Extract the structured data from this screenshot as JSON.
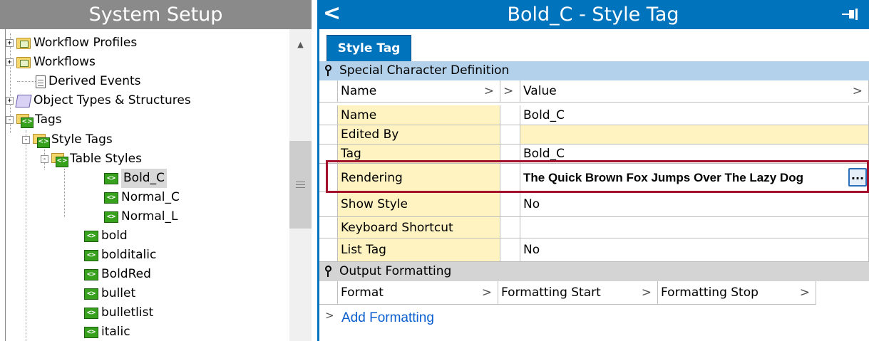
{
  "left_panel": {
    "title": "System Setup",
    "tree": [
      {
        "label": "Workflow Profiles",
        "icon": "folder-icon",
        "expander": "+"
      },
      {
        "label": "Workflows",
        "icon": "folder-icon",
        "expander": "+"
      },
      {
        "label": "Derived Events",
        "icon": "document-icon",
        "expander": ""
      },
      {
        "label": "Object Types & Structures",
        "icon": "object-types-icon",
        "expander": "+"
      },
      {
        "label": "Tags",
        "icon": "tags-folder-icon",
        "expander": "-"
      },
      {
        "label": "Style Tags",
        "icon": "tags-folder-icon",
        "expander": "-"
      },
      {
        "label": "Table Styles",
        "icon": "tags-folder-icon",
        "expander": "-"
      },
      {
        "label": "Bold_C",
        "icon": "tag-icon",
        "selected": true
      },
      {
        "label": "Normal_C",
        "icon": "tag-icon"
      },
      {
        "label": "Normal_L",
        "icon": "tag-icon"
      },
      {
        "label": "bold",
        "icon": "tag-icon"
      },
      {
        "label": "bolditalic",
        "icon": "tag-icon"
      },
      {
        "label": "BoldRed",
        "icon": "tag-icon"
      },
      {
        "label": "bullet",
        "icon": "tag-icon"
      },
      {
        "label": "bulletlist",
        "icon": "tag-icon"
      },
      {
        "label": "italic",
        "icon": "tag-icon"
      }
    ],
    "tag_icon_glyph": "<>",
    "expander_plus": "+",
    "expander_minus": "-"
  },
  "right_panel": {
    "title": "Bold_C - Style Tag",
    "back_glyph": "<",
    "tab": "Style Tag",
    "section1": {
      "header": "Special Character Definition",
      "columns": {
        "name": "Name",
        "value": "Value",
        "chev": ">"
      },
      "rows": [
        {
          "name": "Name",
          "value": "Bold_C"
        },
        {
          "name": "Edited By",
          "value": ""
        },
        {
          "name": "Tag",
          "value": "Bold_C"
        },
        {
          "name": "Rendering",
          "value": "The Quick Brown Fox Jumps Over The Lazy Dog",
          "button": "..."
        },
        {
          "name": "Show Style",
          "value": "No"
        },
        {
          "name": "Keyboard Shortcut",
          "value": ""
        },
        {
          "name": "List Tag",
          "value": "No"
        }
      ]
    },
    "section2": {
      "header": "Output Formatting",
      "columns": [
        "Format",
        "Formatting Start",
        "Formatting Stop"
      ],
      "add_label": "Add Formatting"
    }
  },
  "colors": {
    "title_blue": "#0073bd",
    "section_blue": "#b3d1ea",
    "section_gray": "#d4d4d4",
    "cell_yellow": "#fff3c2",
    "highlight_red": "#a3122a",
    "link_blue": "#0b5fcf"
  }
}
